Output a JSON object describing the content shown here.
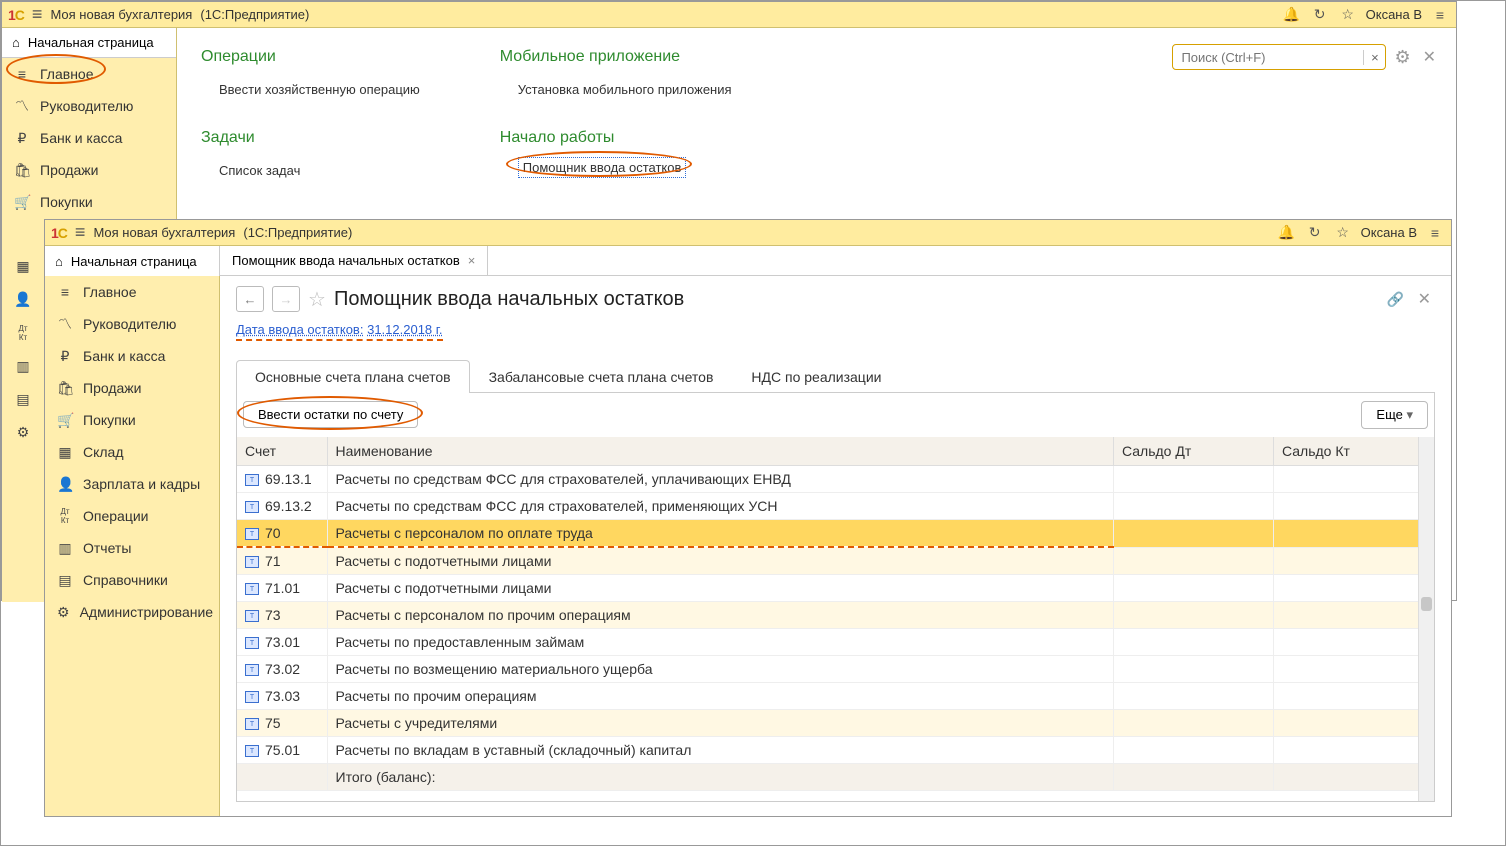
{
  "header": {
    "app_title": "Моя новая бухгалтерия",
    "platform": "(1С:Предприятие)",
    "user_name": "Оксана В"
  },
  "sidebar": {
    "start_page": "Начальная страница",
    "items": [
      {
        "icon": "≡",
        "label": "Главное"
      },
      {
        "icon": "📈",
        "label": "Руководителю"
      },
      {
        "icon": "₽",
        "label": "Банк и касса"
      },
      {
        "icon": "🛍",
        "label": "Продажи"
      },
      {
        "icon": "🛒",
        "label": "Покупки"
      },
      {
        "icon": "📦",
        "label": "Склад"
      },
      {
        "icon": "👤",
        "label": "Зарплата и кадры"
      },
      {
        "icon": "Дт Кт",
        "label": "Операции"
      },
      {
        "icon": "📊",
        "label": "Отчеты"
      },
      {
        "icon": "📚",
        "label": "Справочники"
      },
      {
        "icon": "⚙",
        "label": "Администрирование"
      }
    ]
  },
  "iconstrip": [
    "▦",
    "👤",
    "Дт Кт",
    "📊",
    "📚",
    "⚙"
  ],
  "main1": {
    "search_placeholder": "Поиск (Ctrl+F)",
    "sections": [
      {
        "title": "Операции",
        "links": [
          "Ввести хозяйственную операцию"
        ]
      },
      {
        "title": "Задачи",
        "links": [
          "Список задач"
        ]
      },
      {
        "title": "Мобильное приложение",
        "links": [
          "Установка мобильного приложения"
        ]
      },
      {
        "title": "Начало работы",
        "links": [
          "Помощник ввода остатков"
        ]
      }
    ]
  },
  "win2": {
    "tab_label": "Помощник ввода начальных остатков",
    "panel_title": "Помощник ввода начальных остатков",
    "date_label": "Дата ввода остатков:",
    "date_value": "31.12.2018 г.",
    "subtabs": [
      "Основные счета плана счетов",
      "Забалансовые счета плана счетов",
      "НДС по реализации"
    ],
    "enter_btn": "Ввести остатки по счету",
    "more_btn": "Еще",
    "columns": [
      "Счет",
      "Наименование",
      "Сальдо Дт",
      "Сальдо Кт"
    ],
    "rows": [
      {
        "acct": "69.13.1",
        "name": "Расчеты по средствам ФСС для страхователей, уплачивающих ЕНВД",
        "striped": false
      },
      {
        "acct": "69.13.2",
        "name": "Расчеты по средствам ФСС для страхователей, применяющих УСН",
        "striped": false
      },
      {
        "acct": "70",
        "name": "Расчеты с персоналом по оплате труда",
        "striped": true,
        "selected": true
      },
      {
        "acct": "71",
        "name": "Расчеты с подотчетными лицами",
        "striped": true
      },
      {
        "acct": "71.01",
        "name": "Расчеты с подотчетными лицами",
        "striped": false
      },
      {
        "acct": "73",
        "name": "Расчеты с персоналом по прочим операциям",
        "striped": true
      },
      {
        "acct": "73.01",
        "name": "Расчеты по предоставленным займам",
        "striped": false
      },
      {
        "acct": "73.02",
        "name": "Расчеты по возмещению материального ущерба",
        "striped": false
      },
      {
        "acct": "73.03",
        "name": "Расчеты по прочим операциям",
        "striped": false
      },
      {
        "acct": "75",
        "name": "Расчеты с учредителями",
        "striped": true
      },
      {
        "acct": "75.01",
        "name": "Расчеты по вкладам в уставный (складочный) капитал",
        "striped": false
      }
    ],
    "footer_label": "Итого (баланс):"
  }
}
